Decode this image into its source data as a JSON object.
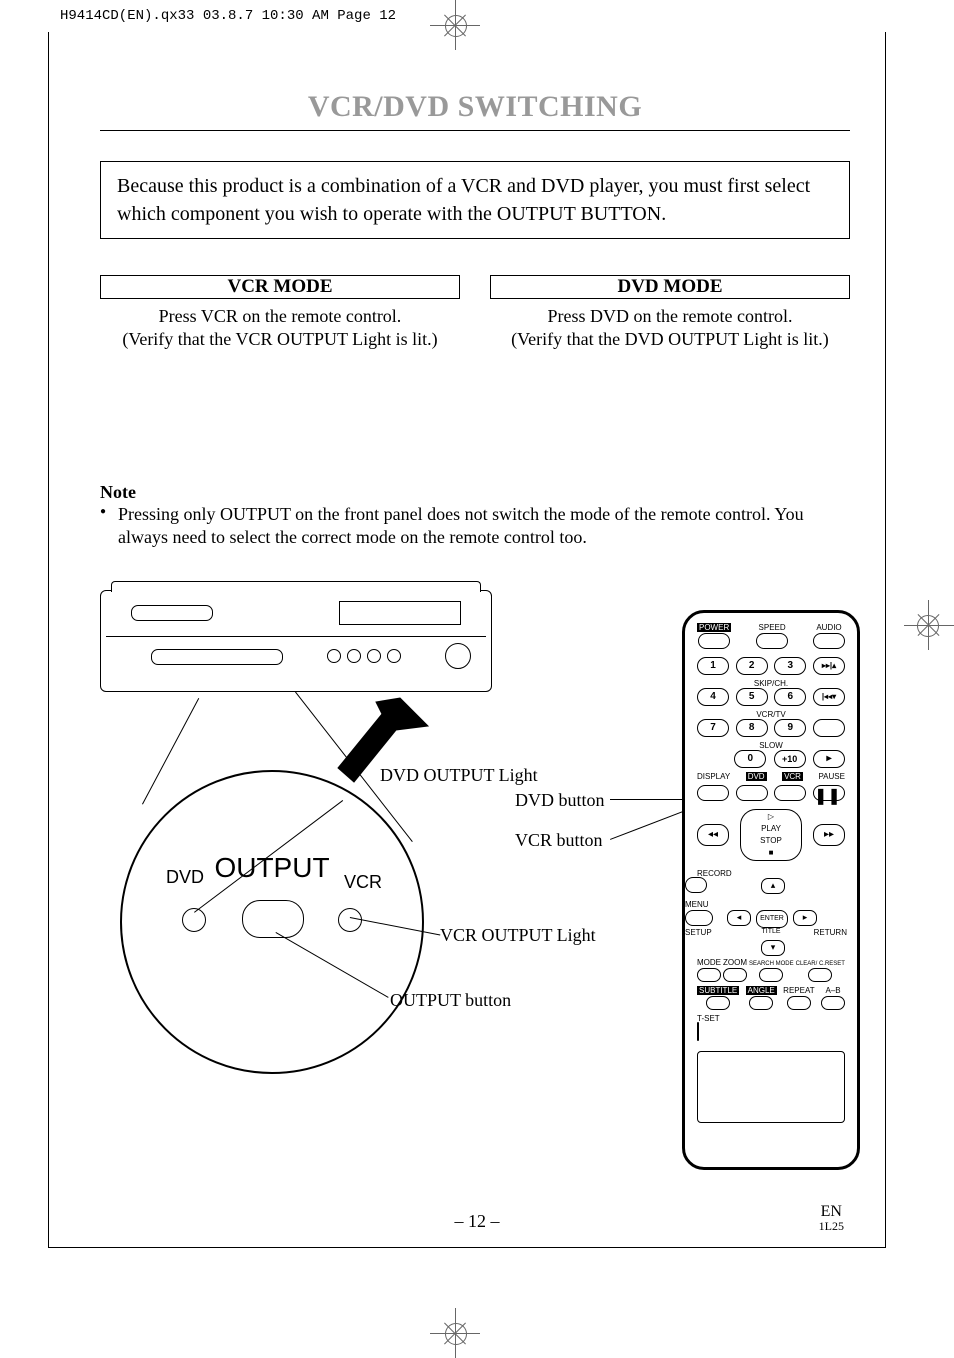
{
  "header_info": "H9414CD(EN).qx33  03.8.7 10:30 AM  Page 12",
  "title": "VCR/DVD SWITCHING",
  "intro": "Because this product is a combination of a VCR and DVD player, you must first select which component you wish to operate with the OUTPUT BUTTON.",
  "vcr_mode": {
    "header": "VCR MODE",
    "line1": "Press VCR on the remote control.",
    "line2": "(Verify that the VCR OUTPUT Light is lit.)"
  },
  "dvd_mode": {
    "header": "DVD MODE",
    "line1": "Press DVD on the remote control.",
    "line2": "(Verify that the DVD OUTPUT Light is lit.)"
  },
  "note_label": "Note",
  "note_text": "Pressing only OUTPUT on the front panel does not switch the mode of the remote control. You always need to select the correct mode on the remote control too.",
  "zoom": {
    "output": "OUTPUT",
    "dvd": "DVD",
    "vcr": "VCR"
  },
  "callouts": {
    "dvd_output_light": "DVD OUTPUT Light",
    "vcr_output_light": "VCR OUTPUT Light",
    "output_button": "OUTPUT button",
    "dvd_button": "DVD button",
    "vcr_button": "VCR button"
  },
  "remote": {
    "power": "POWER",
    "speed": "SPEED",
    "audio": "AUDIO",
    "skipch": "SKIP/CH.",
    "vcrtv": "VCR/TV",
    "slow": "SLOW",
    "display": "DISPLAY",
    "dvd": "DVD",
    "vcr": "VCR",
    "pause": "PAUSE",
    "play": "PLAY",
    "stop": "STOP",
    "record": "RECORD",
    "menu": "MENU",
    "enter": "ENTER",
    "setup": "SETUP",
    "title": "TITLE",
    "return": "RETURN",
    "mode": "MODE",
    "zoom": "ZOOM",
    "searchmode": "SEARCH MODE",
    "clearreset": "CLEAR/ C.RESET",
    "subtitle": "SUBTITLE",
    "angle": "ANGLE",
    "repeat": "REPEAT",
    "ab": "A–B",
    "tset": "T-SET",
    "n1": "1",
    "n2": "2",
    "n3": "3",
    "n4": "4",
    "n5": "5",
    "n6": "6",
    "n7": "7",
    "n8": "8",
    "n9": "9",
    "n0": "0",
    "n10": "+10"
  },
  "page_num": "– 12 –",
  "lang": "EN",
  "lang_sub": "1L25"
}
